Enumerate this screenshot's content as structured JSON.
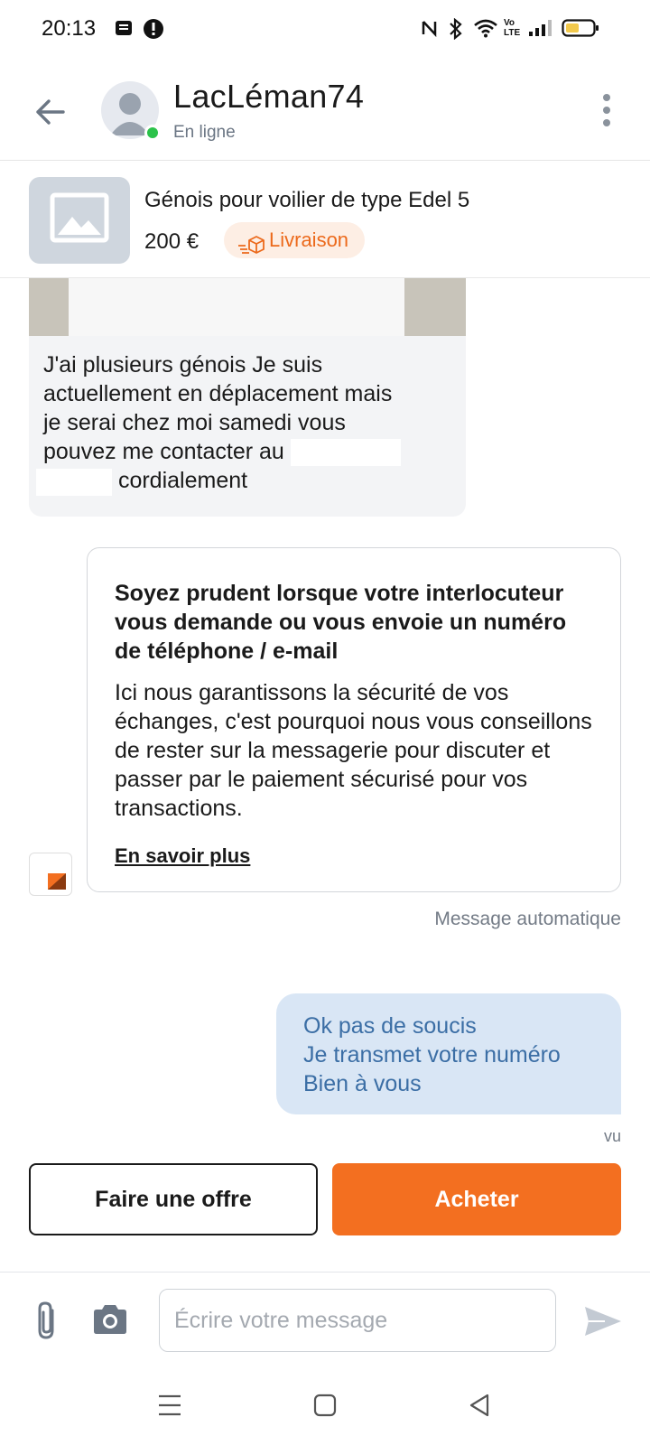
{
  "status_bar": {
    "time": "20:13",
    "icons": [
      "notification-icon",
      "alert-icon",
      "nfc-icon",
      "bluetooth-icon",
      "wifi-icon",
      "volte-icon",
      "signal-icon",
      "battery-icon"
    ],
    "volte_label": "Vo LTE"
  },
  "header": {
    "contact_name": "LacLéman74",
    "presence": "En ligne",
    "presence_color": "#2bc24a"
  },
  "product": {
    "title": "Génois pour voilier de type Edel 5",
    "price": "200 €",
    "badge": "Livraison",
    "badge_color": "#ec6a1c"
  },
  "messages": {
    "received": {
      "line1": "J'ai plusieurs génois Je suis",
      "line2": "actuellement en déplacement mais",
      "line3": "je serai chez moi samedi vous",
      "line4": "pouvez me contacter au",
      "line5": "cordialement"
    },
    "automatic": {
      "title": "Soyez prudent lorsque votre interlocuteur vous demande ou vous envoie un numéro de téléphone / e-mail",
      "body": "Ici nous garantissons la sécurité de vos échanges, c'est pourquoi nous vous conseillons de rester sur la messagerie pour discuter et passer par le paiement sécurisé pour vos transactions.",
      "link": "En savoir plus",
      "caption": "Message automatique"
    },
    "sent": {
      "line1": "Ok pas de soucis",
      "line2": "Je transmet votre numéro",
      "line3": "Bien à vous",
      "status": "vu"
    }
  },
  "actions": {
    "offer_label": "Faire une offre",
    "buy_label": "Acheter",
    "buy_color": "#f36f20"
  },
  "composer": {
    "placeholder": "Écrire votre message"
  }
}
